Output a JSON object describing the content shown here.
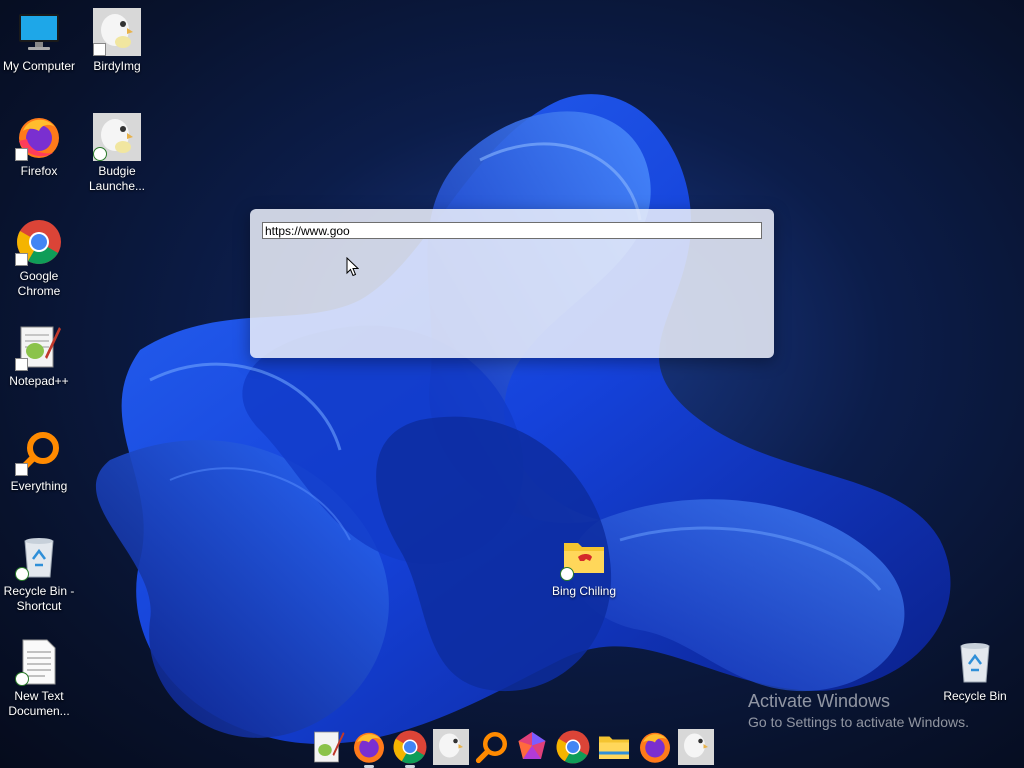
{
  "desktop": {
    "icons": [
      {
        "label": "My Computer",
        "icon": "computer-icon"
      },
      {
        "label": "BirdyImg",
        "icon": "budgie-image-icon"
      },
      {
        "label": "Firefox",
        "icon": "firefox-icon"
      },
      {
        "label": "Budgie Launche...",
        "icon": "budgie-image-icon"
      },
      {
        "label": "Google Chrome",
        "icon": "chrome-icon"
      },
      {
        "label": "Notepad++",
        "icon": "notepadpp-icon"
      },
      {
        "label": "Everything",
        "icon": "magnifier-icon"
      },
      {
        "label": "Recycle Bin - Shortcut",
        "icon": "recycle-bin-icon"
      },
      {
        "label": "New Text Documen...",
        "icon": "text-document-icon"
      },
      {
        "label": "Bing Chiling",
        "icon": "folder-icon"
      },
      {
        "label": "Recycle Bin",
        "icon": "recycle-bin-icon"
      }
    ]
  },
  "dialog": {
    "url_value": "https://www.goo"
  },
  "watermark": {
    "title": "Activate Windows",
    "subtitle": "Go to Settings to activate Windows."
  },
  "taskbar": {
    "items": [
      {
        "icon": "notepadpp-icon"
      },
      {
        "icon": "firefox-icon"
      },
      {
        "icon": "chrome-icon"
      },
      {
        "icon": "budgie-image-icon"
      },
      {
        "icon": "magnifier-icon"
      },
      {
        "icon": "gem-icon"
      },
      {
        "icon": "chrome-icon"
      },
      {
        "icon": "folder-icon"
      },
      {
        "icon": "firefox-icon"
      },
      {
        "icon": "budgie-image-icon"
      }
    ]
  },
  "colors": {
    "accent_blue": "#1f5aff",
    "dialog_bg": "#eef1fa",
    "firefox_orange": "#ff7a1a",
    "chrome_red": "#db4437",
    "chrome_yellow": "#f4b400",
    "chrome_green": "#0f9d58",
    "chrome_blue": "#4285f4"
  }
}
